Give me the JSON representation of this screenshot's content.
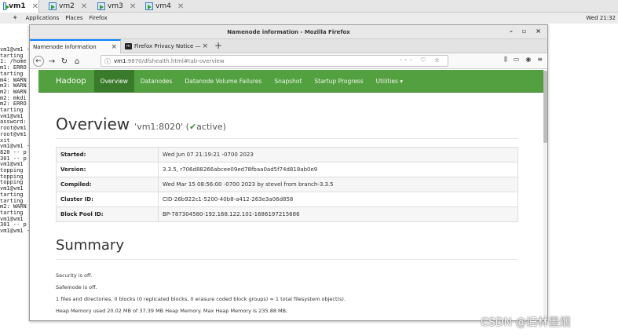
{
  "vm_tabs": [
    {
      "label": "vm1",
      "active": true
    },
    {
      "label": "vm2",
      "active": false
    },
    {
      "label": "vm3",
      "active": false
    },
    {
      "label": "vm4",
      "active": false
    }
  ],
  "gnome": {
    "applications": "Applications",
    "places": "Places",
    "firefox": "Firefox",
    "clock": "Wed 21:32"
  },
  "terminal_lines": [
    "vm1@vm1 -",
    "tarting ",
    "1: /home",
    "m1: ERRO",
    "tarting ",
    "m4: WARN",
    "m3: WARN",
    "m2: WARN",
    "m2: mkdi",
    "m2: ERRO",
    "tarting ",
    "vm1@vm1 ",
    "assword:",
    "root@vm1",
    "root@vm1",
    "xit",
    "vm1@vm1 -",
    "820 -- p",
    "301 -- p",
    "vm1@vm1 ",
    "topping ",
    "topping ",
    "topping ",
    "vm1@vm1 ",
    "tarting ",
    "tarting ",
    "m2: WARN",
    "tarting ",
    "vm1@vm1 ",
    "301 -- p",
    "vm1@vm1 -"
  ],
  "window": {
    "title": "Namenode information - Mozilla Firefox",
    "controls": [
      "–",
      "▫",
      "×"
    ]
  },
  "browser_tabs": [
    {
      "label": "Namenode information",
      "active": true,
      "close": "×"
    },
    {
      "label": "Firefox Privacy Notice —",
      "active": false,
      "close": "×",
      "logo": "m"
    }
  ],
  "new_tab": "+",
  "url": {
    "host": "vm1",
    "path": ":9870/dfshealth.html#tab-overview",
    "icons": "··· ♡ ☆"
  },
  "hadoop_nav": {
    "brand": "Hadoop",
    "items": [
      "Overview",
      "Datanodes",
      "Datanode Volume Failures",
      "Snapshot",
      "Startup Progress",
      "Utilities ▾"
    ],
    "active": 0,
    "color": "#52a03f"
  },
  "overview": {
    "heading": "Overview",
    "host": "'vm1:8020'",
    "status_open": "(",
    "check": "✔",
    "status": "active)"
  },
  "info_rows": [
    {
      "key": "Started:",
      "value": "Wed Jun 07 21:19:21 -0700 2023"
    },
    {
      "key": "Version:",
      "value": "3.3.5, r706d88266abcee09ed78fbaa0ad5f74d818ab0e9"
    },
    {
      "key": "Compiled:",
      "value": "Wed Mar 15 08:56:00 -0700 2023 by stevel from branch-3.3.5"
    },
    {
      "key": "Cluster ID:",
      "value": "CID-26b922c1-5200-40b8-a412-263e3a06d858"
    },
    {
      "key": "Block Pool ID:",
      "value": "BP-787304580-192.168.122.101-1686197215686"
    }
  ],
  "summary": {
    "heading": "Summary",
    "lines": [
      "Security is off.",
      "Safemode is off.",
      "1 files and directories, 0 blocks (0 replicated blocks, 0 erasure coded block groups) = 1 total filesystem object(s).",
      "Heap Memory used 20.02 MB of 37.39 MB Heap Memory. Max Heap Memory is 235.88 MB."
    ]
  },
  "watermark": "CSDN @旧林墨烟"
}
